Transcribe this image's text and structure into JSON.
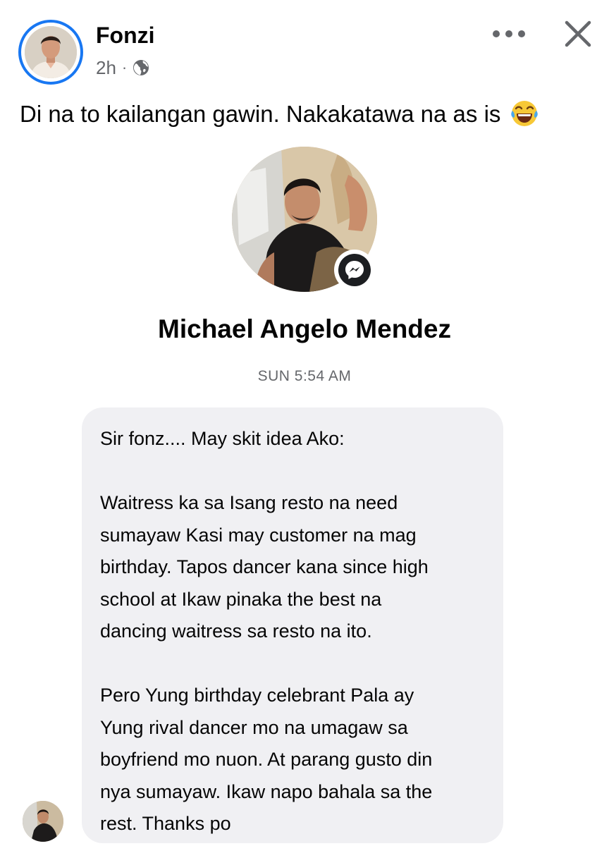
{
  "post": {
    "author_name": "Fonzi",
    "time_ago": "2h",
    "separator": "·",
    "privacy_icon": "globe-icon",
    "more_icon": "more-horizontal-icon",
    "close_icon": "close-icon",
    "caption": "Di na to kailangan gawin. Nakakatawa na as is",
    "caption_emoji": "face-with-tears-of-joy-emoji",
    "accent_color": "#1877f2"
  },
  "shared_screenshot": {
    "contact_name": "Michael Angelo Mendez",
    "badge_icon": "messenger-icon",
    "timestamp": "SUN 5:54 AM",
    "message": {
      "paragraphs": [
        "Sir fonz.... May skit idea Ako:",
        "Waitress ka sa Isang resto na need\nsumayaw Kasi may customer na mag\nbirthday. Tapos dancer kana since high\nschool at Ikaw pinaka the best na\ndancing waitress sa resto na ito.",
        "Pero Yung birthday celebrant Pala ay\nYung rival dancer mo na umagaw sa\nboyfriend mo nuon. At parang gusto din\nnya sumayaw. Ikaw napo bahala sa the\nrest. Thanks po"
      ]
    },
    "bubble_color": "#f0f0f3"
  }
}
